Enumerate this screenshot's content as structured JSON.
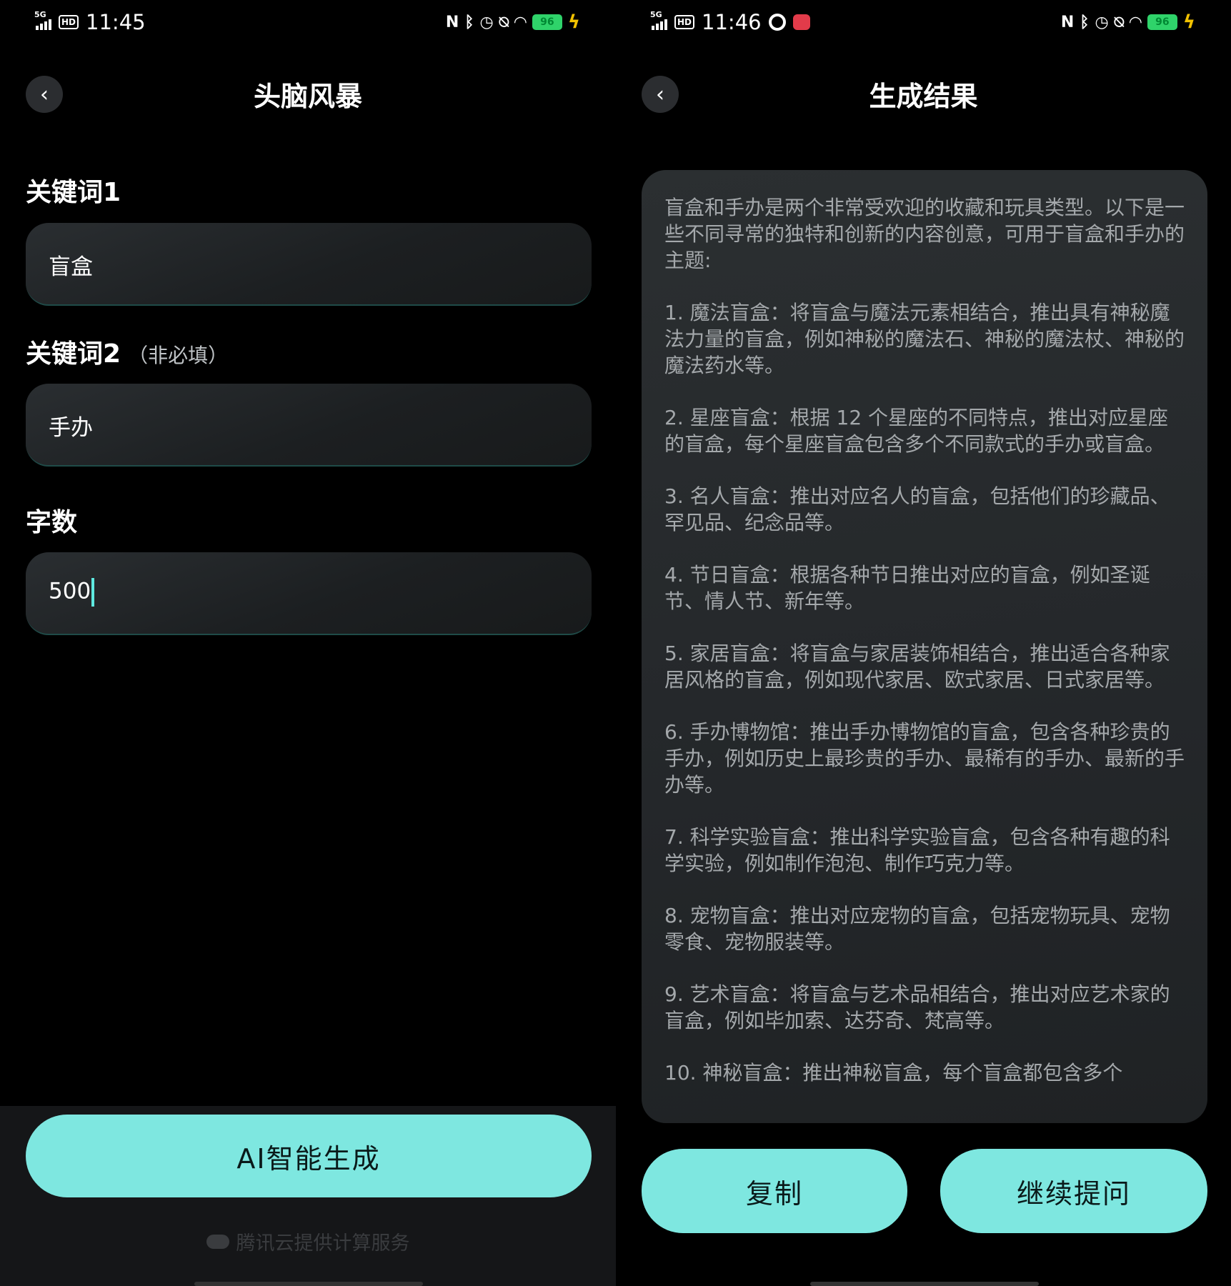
{
  "left": {
    "status": {
      "network": "5G",
      "hd": "HD",
      "time": "11:45",
      "battery": "96"
    },
    "title": "头脑风暴",
    "keyword1": {
      "label": "关键词1",
      "value": "盲盒"
    },
    "keyword2": {
      "label": "关键词2",
      "hint": "（非必填）",
      "value": "手办"
    },
    "word_count": {
      "label": "字数",
      "value": "500"
    },
    "generate_label": "AI智能生成",
    "provider_text": "腾讯云提供计算服务"
  },
  "right": {
    "status": {
      "network": "5G",
      "hd": "HD",
      "time": "11:46",
      "battery": "96"
    },
    "title": "生成结果",
    "paragraphs": [
      "盲盒和手办是两个非常受欢迎的收藏和玩具类型。以下是一些不同寻常的独特和创新的内容创意，可用于盲盒和手办的主题:",
      "1. 魔法盲盒：将盲盒与魔法元素相结合，推出具有神秘魔法力量的盲盒，例如神秘的魔法石、神秘的魔法杖、神秘的魔法药水等。",
      "2. 星座盲盒：根据 12 个星座的不同特点，推出对应星座的盲盒，每个星座盲盒包含多个不同款式的手办或盲盒。",
      "3. 名人盲盒：推出对应名人的盲盒，包括他们的珍藏品、罕见品、纪念品等。",
      "4. 节日盲盒：根据各种节日推出对应的盲盒，例如圣诞节、情人节、新年等。",
      "5. 家居盲盒：将盲盒与家居装饰相结合，推出适合各种家居风格的盲盒，例如现代家居、欧式家居、日式家居等。",
      "6. 手办博物馆：推出手办博物馆的盲盒，包含各种珍贵的手办，例如历史上最珍贵的手办、最稀有的手办、最新的手办等。",
      "7. 科学实验盲盒：推出科学实验盲盒，包含各种有趣的科学实验，例如制作泡泡、制作巧克力等。",
      "8. 宠物盲盒：推出对应宠物的盲盒，包括宠物玩具、宠物零食、宠物服装等。",
      "9. 艺术盲盒：将盲盒与艺术品相结合，推出对应艺术家的盲盒，例如毕加索、达芬奇、梵高等。",
      "10. 神秘盲盒：推出神秘盲盒，每个盲盒都包含多个"
    ],
    "copy_label": "复制",
    "continue_label": "继续提问"
  },
  "icons": {
    "back": "chevron-left-icon",
    "status_right": [
      "nfc-icon",
      "bluetooth-icon",
      "alarm-icon",
      "mute-icon",
      "wifi-icon",
      "battery-icon",
      "charging-icon"
    ]
  },
  "colors": {
    "accent": "#7ee7e0",
    "caret": "#5ee9e0",
    "background": "#000000",
    "card": "#24272a"
  }
}
